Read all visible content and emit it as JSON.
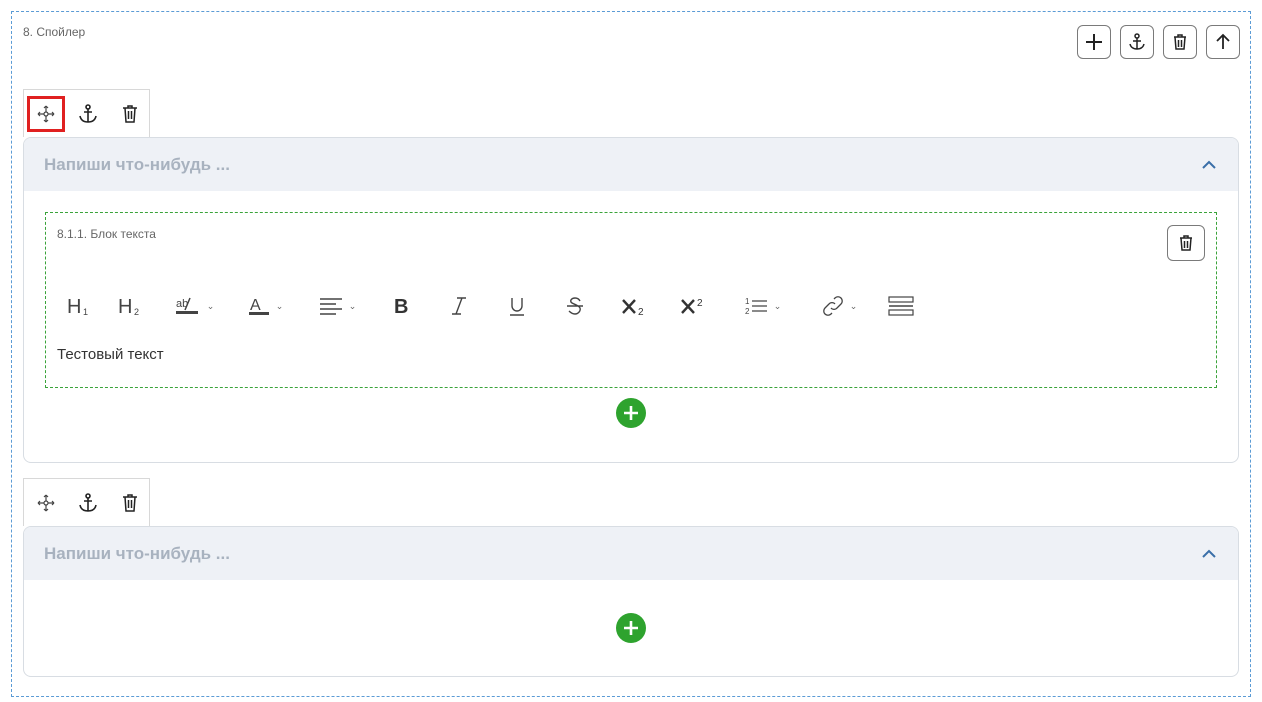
{
  "block": {
    "label": "8. Спойлер",
    "actions": [
      "add-icon",
      "anchor-icon",
      "trash-icon",
      "arrow-up-icon"
    ]
  },
  "spoilers": [
    {
      "title": "Напиши что-нибудь ...",
      "text_block": {
        "label": "8.1.1. Блок текста",
        "content": "Тестовый текст"
      }
    },
    {
      "title": "Напиши что-нибудь ..."
    }
  ],
  "toolbar": {
    "items": [
      "H1",
      "H2",
      "highlight",
      "font-color",
      "align",
      "bold",
      "italic",
      "underline",
      "strikethrough",
      "subscript",
      "superscript",
      "ordered-list",
      "link",
      "horizontal-line"
    ]
  },
  "colors": {
    "outer_border": "#5b9bd5",
    "text_block_border": "#3aa33a",
    "add_button": "#2ea32e",
    "selected_tool": "#e02020",
    "spoiler_header": "#eef1f6",
    "spoiler_title": "#a8b2bf"
  }
}
